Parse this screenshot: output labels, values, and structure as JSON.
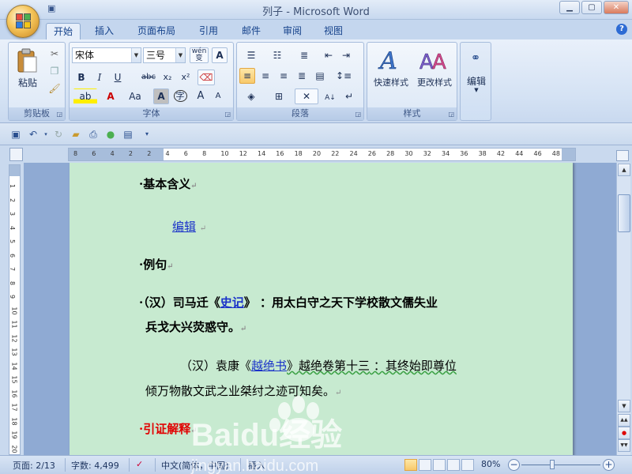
{
  "window": {
    "title": "列子 - Microsoft Word",
    "min_label": "▁",
    "max_label": "▢",
    "close_label": "✕"
  },
  "tabs": [
    {
      "label": "开始",
      "active": true
    },
    {
      "label": "插入"
    },
    {
      "label": "页面布局"
    },
    {
      "label": "引用"
    },
    {
      "label": "邮件"
    },
    {
      "label": "审阅"
    },
    {
      "label": "视图"
    }
  ],
  "help_label": "?",
  "ribbon": {
    "clipboard": {
      "label": "剪贴板",
      "paste_label": "粘贴"
    },
    "font": {
      "label": "字体",
      "font_name": "宋体",
      "font_size": "三号",
      "wen_label": "wén 变",
      "a_label": "A",
      "bold": "B",
      "italic": "I",
      "underline": "U",
      "strike": "abc",
      "subscript": "x₂",
      "superscript": "x²",
      "clear": "Aa",
      "grow": "A",
      "shrink": "A",
      "enclose": "字",
      "shade": "A"
    },
    "paragraph": {
      "label": "段落"
    },
    "styles": {
      "label": "样式",
      "quick_styles": "快速样式",
      "change_styles": "更改样式"
    },
    "editing": {
      "label": "编辑"
    }
  },
  "ruler_ticks": [
    "8",
    "6",
    "4",
    "2",
    "2",
    "4",
    "6",
    "8",
    "10",
    "12",
    "14",
    "16",
    "18",
    "20",
    "22",
    "24",
    "26",
    "28",
    "30",
    "32",
    "34",
    "36",
    "38",
    "42",
    "44",
    "46",
    "48"
  ],
  "vruler_ticks": [
    "1",
    "2",
    "3",
    "4",
    "5",
    "6",
    "7",
    "8",
    "9",
    "10",
    "11",
    "12",
    "13",
    "14",
    "15",
    "16",
    "17",
    "18",
    "19",
    "20"
  ],
  "document": {
    "p1": "基本含义",
    "p2": "编辑",
    "p3": "例句",
    "p4_prefix": "（汉）司马迁《",
    "p4_link": "史记",
    "p4_suffix": "》 ：用太白守之天下学校散文儒失业",
    "p5": "兵戈大兴荧惑守。",
    "p6_prefix": "（汉）袁康《",
    "p6_link": "越绝书",
    "p6_mid": "》越绝卷第十三",
    "p6_suffix": " ：其终始即尊位",
    "p7": "倾万物散文武之业桀纣之迹可知矣。",
    "p8": "引证解释",
    "para_mark": "↵"
  },
  "status": {
    "page": "页面: 2/13",
    "words": "字数: 4,499",
    "lang": "中文(简体，中国)",
    "mode": "插入",
    "zoom": "80%",
    "zoom_minus": "−",
    "zoom_plus": "+"
  },
  "watermark": {
    "brand": "Baidu经验",
    "url": "jingyan.baidu.com"
  },
  "colors": {
    "page_bg": "#c7ead0",
    "link": "#1a32c9",
    "red_heading": "#e10000"
  }
}
